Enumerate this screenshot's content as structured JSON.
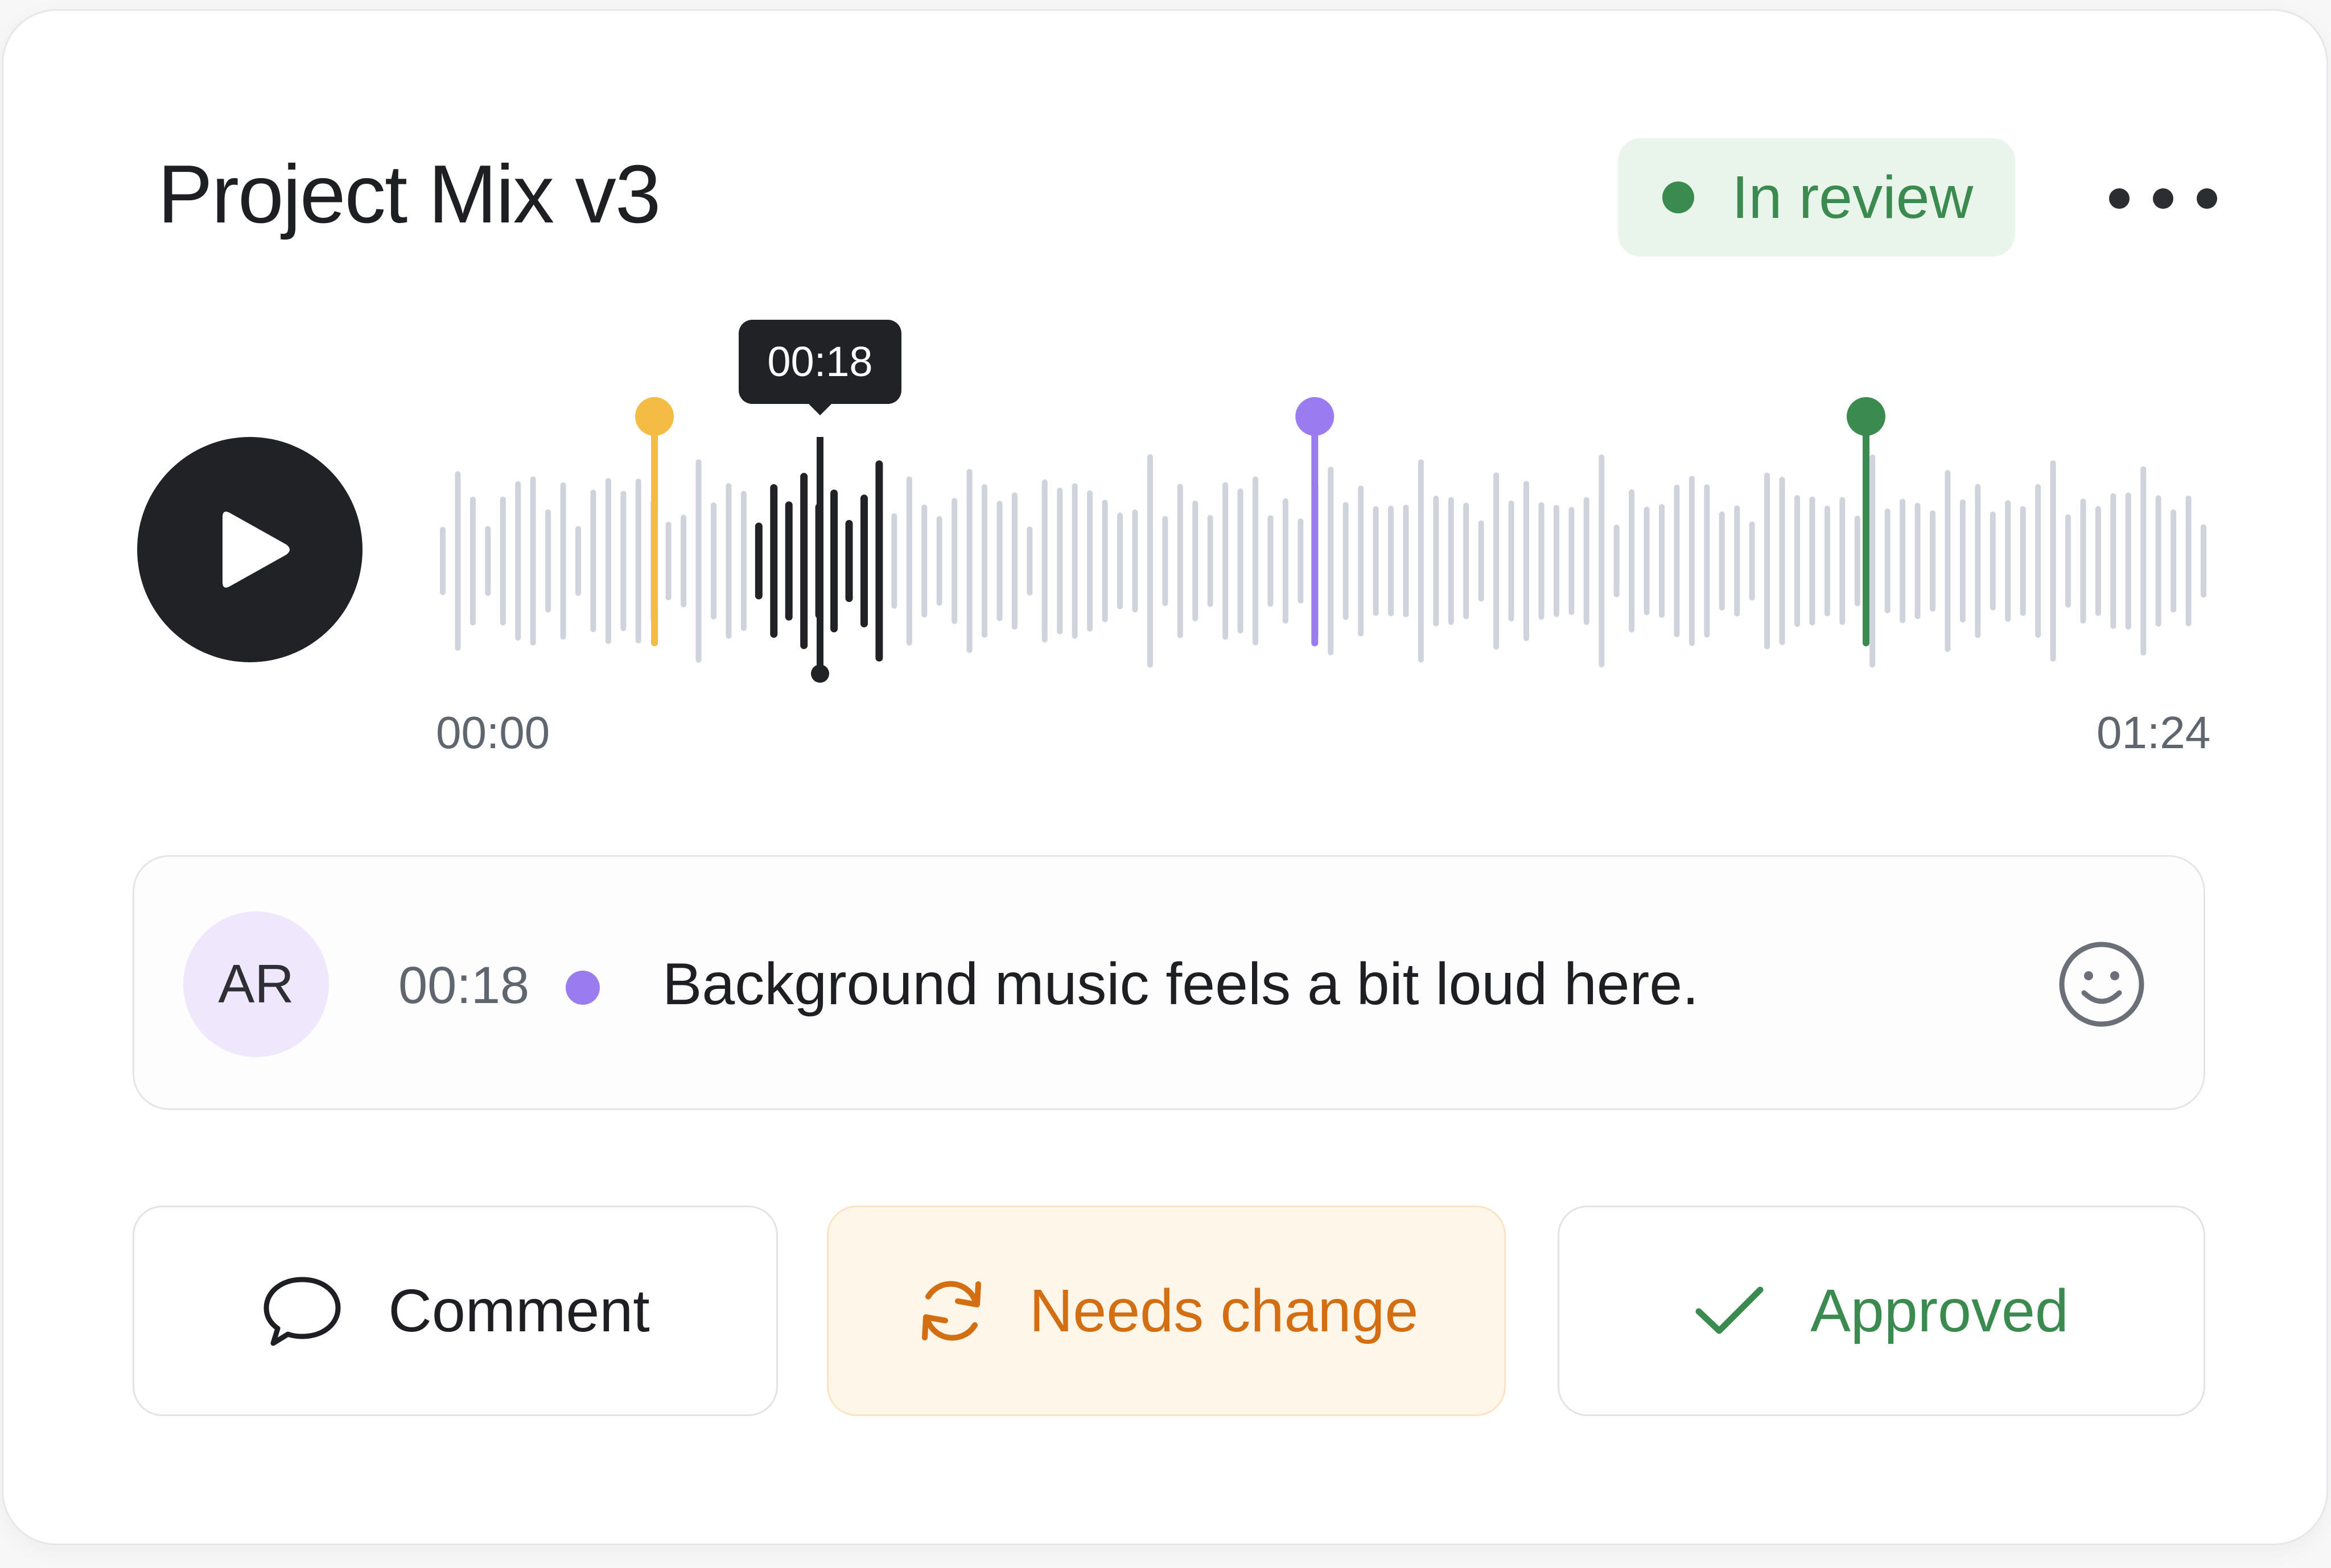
{
  "header": {
    "title": "Project Mix v3",
    "status": {
      "label": "In review",
      "color": "#3b8a4f"
    },
    "more_icon": "ellipsis-horizontal-icon"
  },
  "player": {
    "play_icon": "play-icon",
    "current_time": "00:18",
    "start_time": "00:00",
    "end_time": "01:24",
    "duration_seconds": 84,
    "playhead_seconds": 18,
    "markers": [
      {
        "name": "marker-yellow",
        "seconds": 10.1,
        "color": "#f4bb45"
      },
      {
        "name": "marker-purple",
        "seconds": 41.6,
        "color": "#9b7cf0"
      },
      {
        "name": "marker-green",
        "seconds": 67.9,
        "color": "#3b8a4f"
      }
    ]
  },
  "comment": {
    "avatar_initials": "AR",
    "time": "00:18",
    "text": "Background music feels a bit loud here.",
    "dot_color": "#9b7cf0",
    "emoji_icon": "smiley-face-icon"
  },
  "actions": {
    "comment": {
      "label": "Comment",
      "icon": "speech-bubble-icon"
    },
    "needs_change": {
      "label": "Needs change",
      "icon": "refresh-icon",
      "color": "#d46e13"
    },
    "approved": {
      "label": "Approved",
      "icon": "checkmark-icon",
      "color": "#3b8a4f"
    }
  }
}
